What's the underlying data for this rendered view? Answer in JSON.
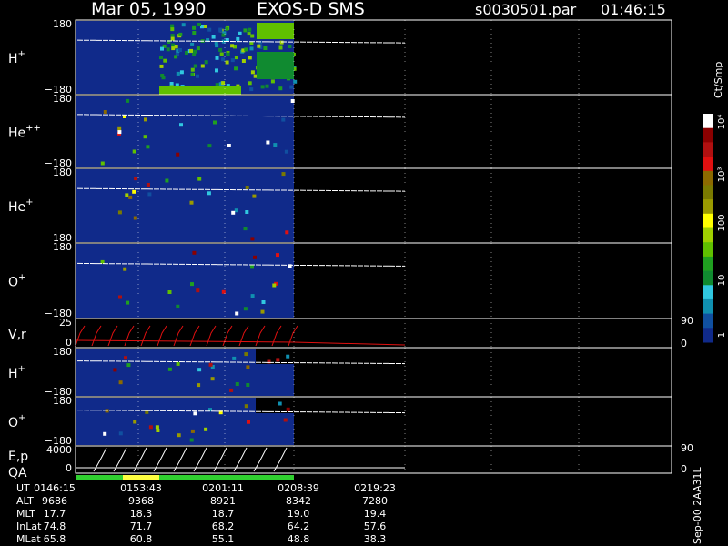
{
  "header": {
    "date": "Mar 05, 1990",
    "instrument": "EXOS-D SMS",
    "file": "s0030501.par",
    "time": "01:46:15"
  },
  "colorbar": {
    "label": "Ct/Smp",
    "ticks": [
      "10⁴",
      "10³",
      "100",
      "10",
      "1"
    ],
    "colors": [
      "#ffffff",
      "#8b0000",
      "#b01010",
      "#e01010",
      "#8c6a00",
      "#7a7a00",
      "#9a9a00",
      "#ffff00",
      "#a0d000",
      "#60c000",
      "#20a020",
      "#108a30",
      "#30c8e0",
      "#1090b0",
      "#1050a0",
      "#102a8a"
    ]
  },
  "chart_data": [
    {
      "type": "heatmap",
      "label": "H",
      "sup": "+",
      "ylim": [
        -180,
        180
      ],
      "yticks": [
        "180",
        "−180"
      ],
      "data_end_ut": "0208:39"
    },
    {
      "type": "heatmap",
      "label": "He",
      "sup": "++",
      "ylim": [
        -180,
        180
      ],
      "yticks": [
        "180",
        "−180"
      ],
      "data_end_ut": "0208:39"
    },
    {
      "type": "heatmap",
      "label": "He",
      "sup": "+",
      "ylim": [
        -180,
        180
      ],
      "yticks": [
        "180",
        "−180"
      ],
      "data_end_ut": "0208:39"
    },
    {
      "type": "heatmap",
      "label": "O",
      "sup": "+",
      "ylim": [
        -180,
        180
      ],
      "yticks": [
        "180",
        "−180"
      ],
      "data_end_ut": "0208:39"
    },
    {
      "type": "line",
      "label": "V,r",
      "ylim": [
        0,
        25
      ],
      "yticks": [
        "25",
        "0"
      ],
      "right_ticks": [
        "90",
        "0"
      ]
    },
    {
      "type": "heatmap",
      "label": "H",
      "sup": "+",
      "ylim": [
        -180,
        180
      ],
      "yticks": [
        "180",
        "−180"
      ]
    },
    {
      "type": "heatmap",
      "label": "O",
      "sup": "+",
      "ylim": [
        -180,
        180
      ],
      "yticks": [
        "180",
        "−180"
      ]
    },
    {
      "type": "line",
      "label": "E,p",
      "label2": "QA",
      "ylim": [
        0,
        4000
      ],
      "yticks": [
        "4000",
        "0"
      ],
      "right_ticks": [
        "90",
        "0"
      ]
    }
  ],
  "ephemeris": {
    "row_labels": [
      "UT",
      "ALT",
      "MLT",
      "InLat",
      "MLat"
    ],
    "columns": [
      [
        "0146:15",
        "9686",
        "17.7",
        "74.8",
        "65.8"
      ],
      [
        "0153:43",
        "9368",
        "18.3",
        "71.7",
        "60.8"
      ],
      [
        "0201:11",
        "8921",
        "18.7",
        "68.2",
        "55.1"
      ],
      [
        "0208:39",
        "8342",
        "19.0",
        "64.2",
        "48.8"
      ],
      [
        "0219:23",
        "7280",
        "19.4",
        "57.6",
        "38.3"
      ]
    ]
  },
  "footer_code": "Sep-00 2AA31L"
}
